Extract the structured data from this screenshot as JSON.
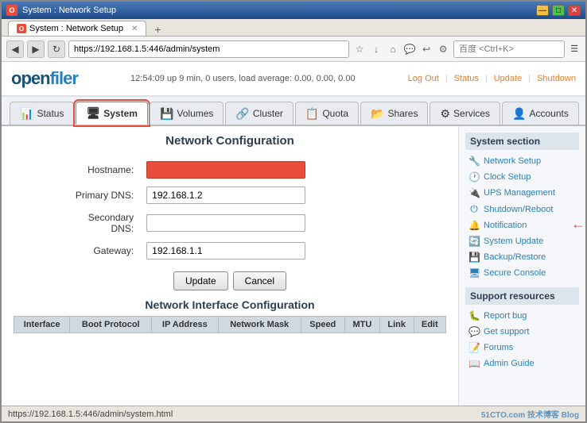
{
  "window": {
    "title": "System : Network Setup",
    "favicon": "O"
  },
  "browser": {
    "tab_label": "System : Network Setup",
    "address": "https://192.168.1.5:446/admin/system",
    "search_placeholder": "百度 <Ctrl+K>",
    "status_url": "https://192.168.1.5:446/admin/system.html"
  },
  "header": {
    "logo": "openfiler",
    "status": "12:54:09 up 9 min, 0 users, load average: 0.00, 0.00, 0.00",
    "links": [
      "Log Out",
      "Status",
      "Update",
      "Shutdown"
    ]
  },
  "nav": {
    "tabs": [
      {
        "id": "status",
        "label": "Status",
        "icon": "📊"
      },
      {
        "id": "system",
        "label": "System",
        "icon": "🖥",
        "active": true
      },
      {
        "id": "volumes",
        "label": "Volumes",
        "icon": "💾"
      },
      {
        "id": "cluster",
        "label": "Cluster",
        "icon": "🔗"
      },
      {
        "id": "quota",
        "label": "Quota",
        "icon": "📋"
      },
      {
        "id": "shares",
        "label": "Shares",
        "icon": "📂"
      },
      {
        "id": "services",
        "label": "Services",
        "icon": "⚙"
      },
      {
        "id": "accounts",
        "label": "Accounts",
        "icon": "👤"
      }
    ]
  },
  "network_config": {
    "title": "Network Configuration",
    "hostname_label": "Hostname:",
    "hostname_value": "",
    "primary_dns_label": "Primary DNS:",
    "primary_dns_value": "192.168.1.2",
    "secondary_dns_label": "Secondary DNS:",
    "secondary_dns_value": "",
    "gateway_label": "Gateway:",
    "gateway_value": "192.168.1.1",
    "btn_update": "Update",
    "btn_cancel": "Cancel"
  },
  "network_interface": {
    "title": "Network Interface Configuration",
    "columns": [
      "Interface",
      "Boot Protocol",
      "IP Address",
      "Network Mask",
      "Speed",
      "MTU",
      "Link",
      "Edit"
    ]
  },
  "sidebar": {
    "system_section_title": "System section",
    "items": [
      {
        "id": "network-setup",
        "label": "Network Setup",
        "icon": "🔧"
      },
      {
        "id": "clock-setup",
        "label": "Clock Setup",
        "icon": "🕐"
      },
      {
        "id": "ups-management",
        "label": "UPS Management",
        "icon": "🔌"
      },
      {
        "id": "shutdown-reboot",
        "label": "Shutdown/Reboot",
        "icon": "⏻"
      },
      {
        "id": "notification",
        "label": "Notification",
        "icon": "🔔"
      },
      {
        "id": "system-update",
        "label": "System Update",
        "icon": "🔄"
      },
      {
        "id": "backup-restore",
        "label": "Backup/Restore",
        "icon": "💾"
      },
      {
        "id": "secure-console",
        "label": "Secure Console",
        "icon": "🖥"
      }
    ],
    "support_section_title": "Support resources",
    "support_items": [
      {
        "id": "report-bug",
        "label": "Report bug",
        "icon": "🐛"
      },
      {
        "id": "get-support",
        "label": "Get support",
        "icon": "💬"
      },
      {
        "id": "forums",
        "label": "Forums",
        "icon": "📝"
      },
      {
        "id": "admin-guide",
        "label": "Admin Guide",
        "icon": "📖"
      }
    ]
  },
  "watermark": {
    "line1": "51CTO.com",
    "line2": "技术博客",
    "line3": "Blog"
  }
}
